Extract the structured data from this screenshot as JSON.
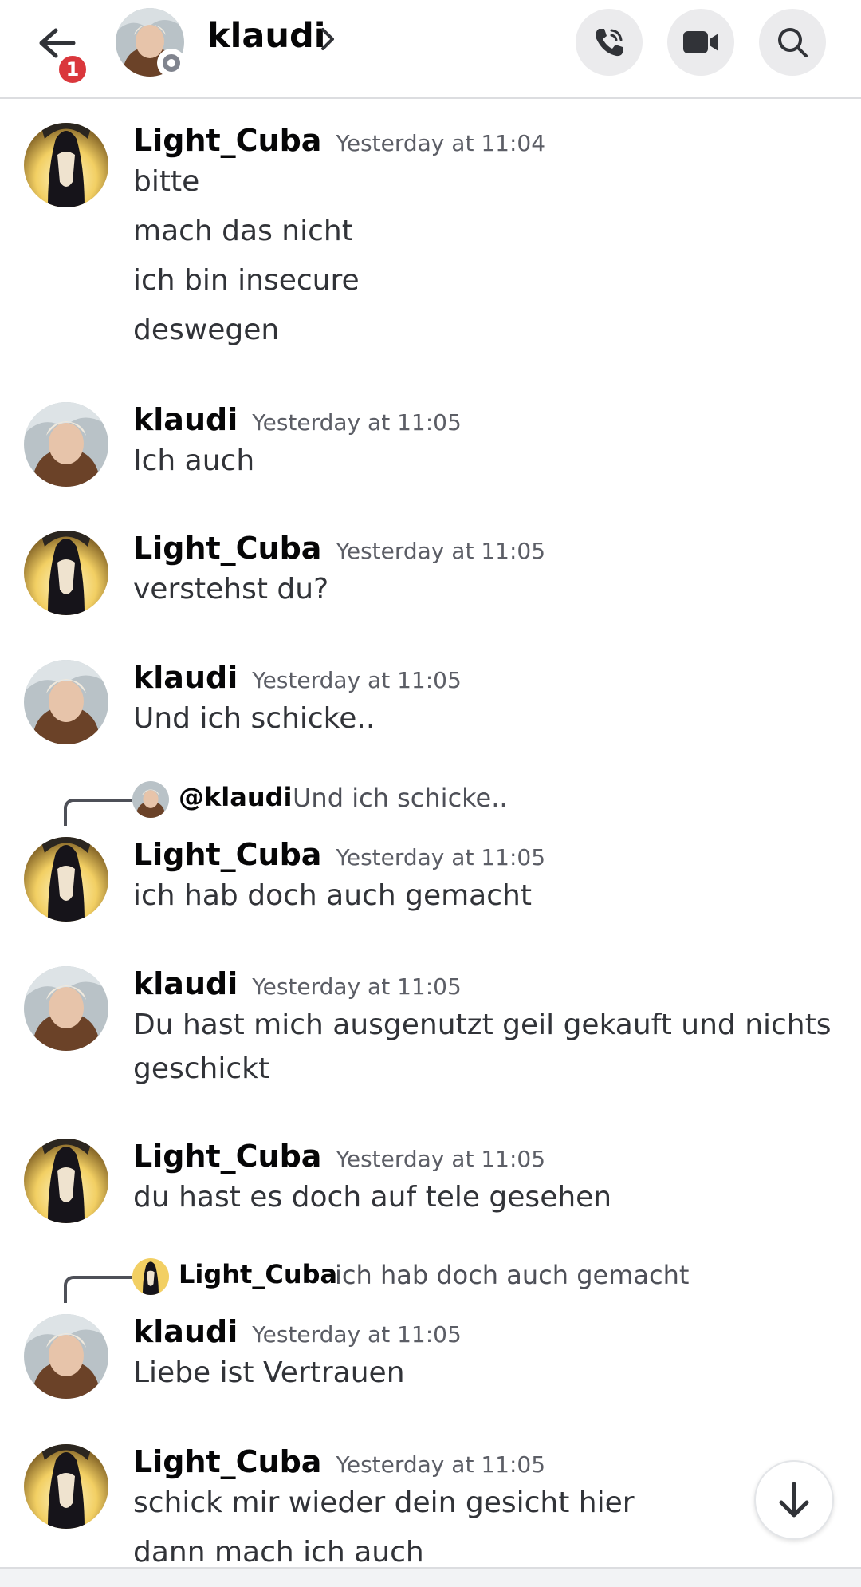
{
  "header": {
    "unread_count": "1",
    "contact_name": "klaudi",
    "call_label": "voice-call",
    "video_label": "video-call",
    "search_label": "search"
  },
  "messages": [
    {
      "author": "Light_Cuba",
      "time": "Yesterday at 11:04",
      "lines": [
        "bitte",
        "mach das nicht",
        "ich bin insecure",
        "deswegen"
      ]
    },
    {
      "author": "klaudi",
      "time": "Yesterday at 11:05",
      "lines": [
        "Ich auch"
      ]
    },
    {
      "author": "Light_Cuba",
      "time": "Yesterday at 11:05",
      "lines": [
        "verstehst du?"
      ]
    },
    {
      "author": "klaudi",
      "time": "Yesterday at 11:05",
      "lines": [
        "Und ich schicke.."
      ]
    },
    {
      "author": "Light_Cuba",
      "time": "Yesterday at 11:05",
      "lines": [
        "ich hab doch auch gemacht"
      ],
      "reply": {
        "author": "@klaudi",
        "text": "Und ich schicke.."
      }
    },
    {
      "author": "klaudi",
      "time": "Yesterday at 11:05",
      "lines": [
        "Du hast mich ausgenutzt geil gekauft und nichts",
        "geschickt"
      ]
    },
    {
      "author": "Light_Cuba",
      "time": "Yesterday at 11:05",
      "lines": [
        "du hast es doch auf tele gesehen"
      ]
    },
    {
      "author": "klaudi",
      "time": "Yesterday at 11:05",
      "lines": [
        "Liebe ist Vertrauen"
      ],
      "reply": {
        "author": "Light_Cuba",
        "text": "ich hab doch auch gemacht"
      }
    },
    {
      "author": "Light_Cuba",
      "time": "Yesterday at 11:05",
      "lines": [
        "schick mir wieder dein gesicht hier",
        "dann mach ich auch"
      ]
    }
  ],
  "icons": {
    "back": "arrow-left-icon",
    "phone": "phone-icon",
    "video": "video-camera-icon",
    "search": "search-icon",
    "jump": "arrow-down-icon"
  },
  "colors": {
    "badge": "#da373c",
    "status_offline": "#80848e",
    "text_primary": "#060607",
    "text_secondary": "#5c5e66"
  }
}
